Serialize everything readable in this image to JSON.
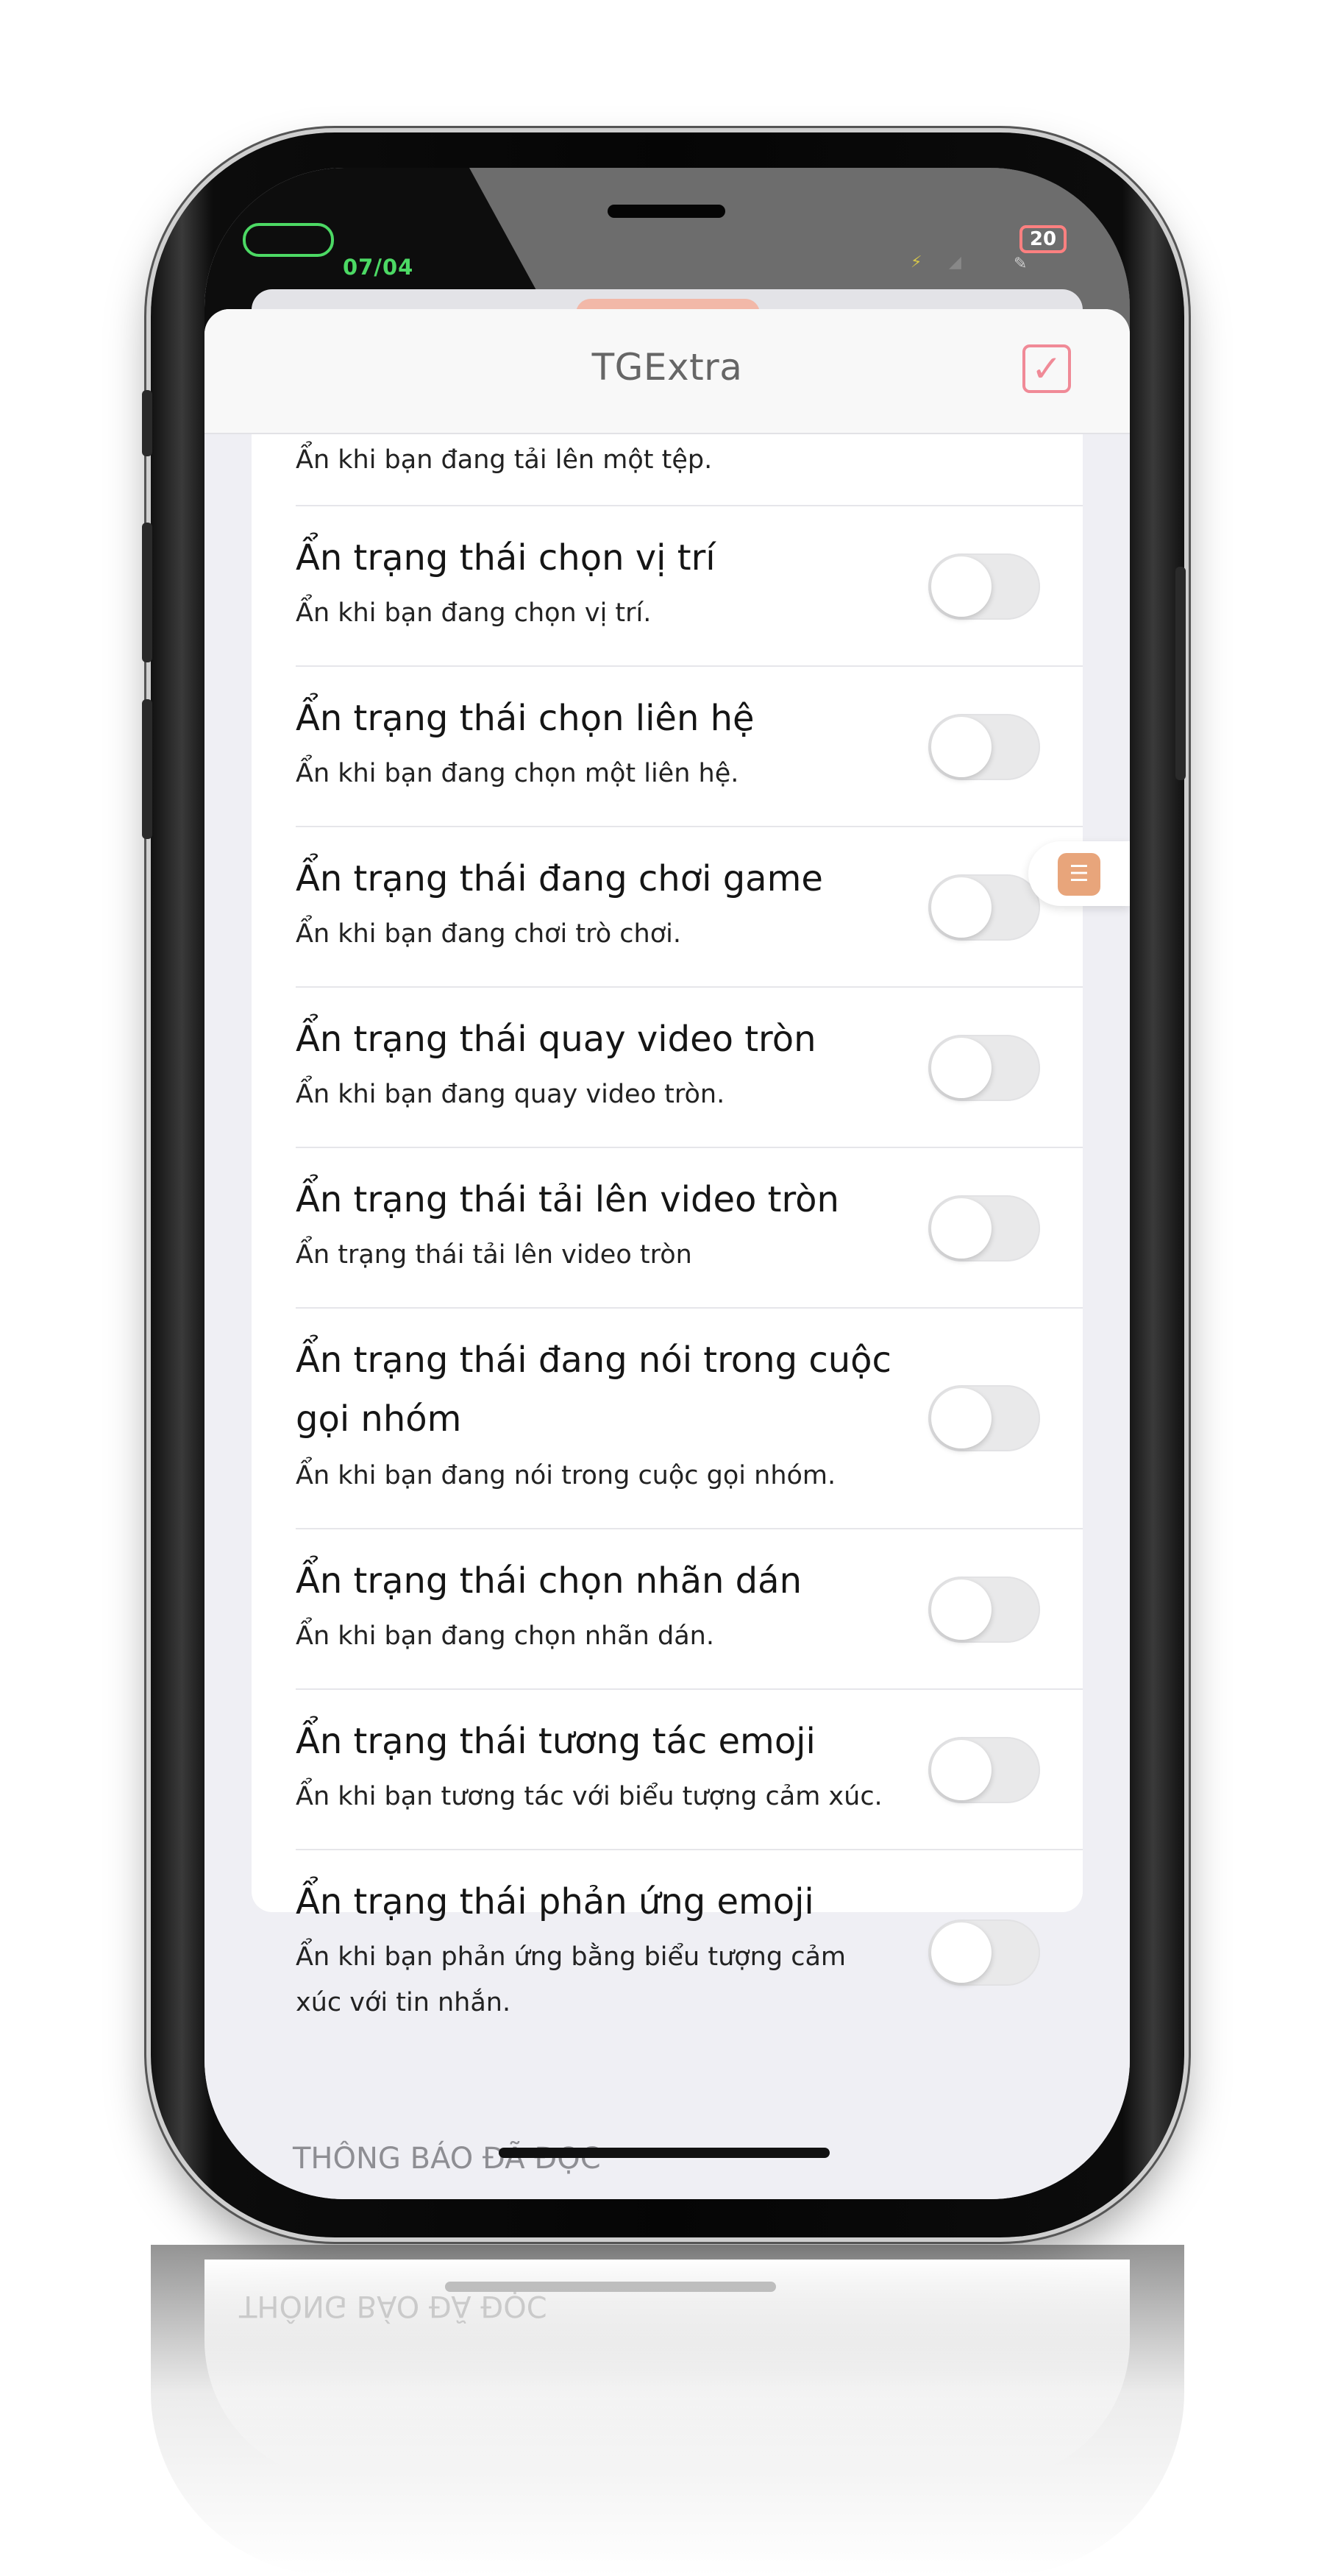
{
  "status_bar": {
    "date": "07/04",
    "battery": "20"
  },
  "nav": {
    "title": "TGExtra",
    "done_icon": "checkmark-icon"
  },
  "rows": [
    {
      "title": "",
      "subtitle": "Ẩn khi bạn đang tải lên một tệp.",
      "enabled": false
    },
    {
      "title": "Ẩn trạng thái chọn vị trí",
      "subtitle": "Ẩn khi bạn đang chọn vị trí.",
      "enabled": false
    },
    {
      "title": "Ẩn trạng thái chọn liên hệ",
      "subtitle": "Ẩn khi bạn đang chọn một liên hệ.",
      "enabled": false
    },
    {
      "title": "Ẩn trạng thái đang chơi game",
      "subtitle": "Ẩn khi bạn đang chơi trò chơi.",
      "enabled": false
    },
    {
      "title": "Ẩn trạng thái quay video tròn",
      "subtitle": "Ẩn khi bạn đang quay video tròn.",
      "enabled": false
    },
    {
      "title": "Ẩn trạng thái tải lên video tròn",
      "subtitle": "Ẩn trạng thái tải lên video tròn",
      "enabled": false
    },
    {
      "title": "Ẩn trạng thái đang nói trong cuộc gọi nhóm",
      "subtitle": "Ẩn khi bạn đang nói trong cuộc gọi nhóm.",
      "enabled": false
    },
    {
      "title": "Ẩn trạng thái chọn nhãn dán",
      "subtitle": "Ẩn khi bạn đang chọn nhãn dán.",
      "enabled": false
    },
    {
      "title": "Ẩn trạng thái tương tác emoji",
      "subtitle": "Ẩn khi bạn tương tác với biểu tượng cảm xúc.",
      "enabled": false
    },
    {
      "title": "Ẩn trạng thái phản ứng emoji",
      "subtitle": "Ẩn khi bạn phản ứng bằng biểu tượng cảm xúc với tin nhắn.",
      "enabled": false
    }
  ],
  "section_footer": "THÔNG BÁO ĐÃ ĐỌC",
  "floating_button": {
    "icon": "notes-icon"
  }
}
